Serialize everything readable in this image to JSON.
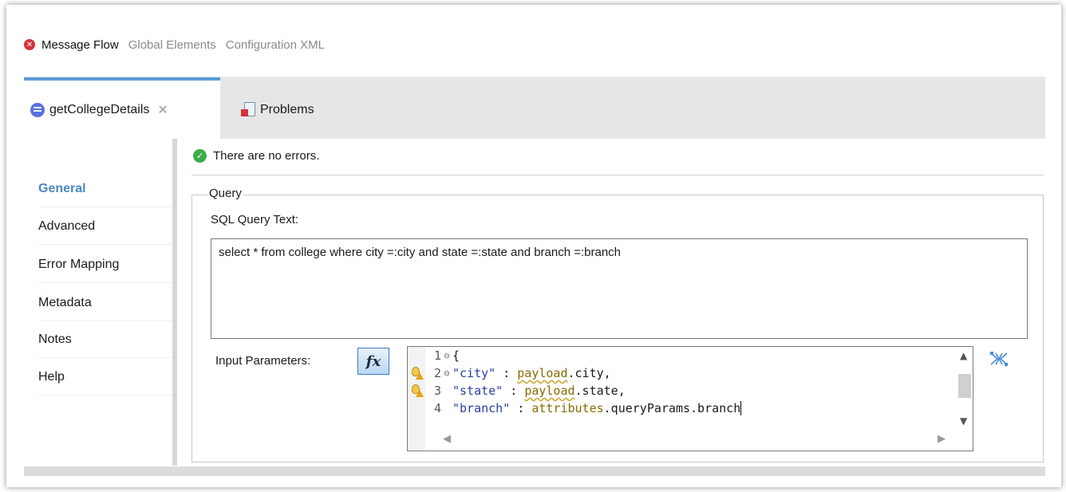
{
  "editor_tabs": [
    {
      "label": "Message Flow",
      "active": true
    },
    {
      "label": "Global Elements",
      "active": false
    },
    {
      "label": "Configuration XML",
      "active": false
    }
  ],
  "view_tabs": {
    "active": {
      "label": "getCollegeDetails",
      "icon": "database-icon"
    },
    "inactive": {
      "label": "Problems",
      "icon": "problems-icon"
    }
  },
  "sidebar": {
    "items": [
      {
        "label": "General",
        "active": true
      },
      {
        "label": "Advanced",
        "active": false
      },
      {
        "label": "Error Mapping",
        "active": false
      },
      {
        "label": "Metadata",
        "active": false
      },
      {
        "label": "Notes",
        "active": false
      },
      {
        "label": "Help",
        "active": false
      }
    ]
  },
  "status": {
    "text": "There are no errors."
  },
  "query": {
    "group_label": "Query",
    "sql_label": "SQL Query Text:",
    "sql_text": "select * from college where city =:city and state =:state and branch =:branch",
    "input_params_label": "Input Parameters:",
    "fx_label": "fx",
    "code": {
      "line1": {
        "num": "1",
        "text": "{"
      },
      "line2": {
        "num": "2",
        "key": "\"city\"",
        "sep": " : ",
        "obj": "payload",
        "rest": ".city,"
      },
      "line3": {
        "num": "3",
        "key": "\"state\"",
        "sep": " : ",
        "obj": "payload",
        "rest": ".state,"
      },
      "line4": {
        "num": "4",
        "key": "\"branch\"",
        "sep": " : ",
        "obj": "attributes",
        "rest": ".queryParams.branch"
      }
    }
  },
  "colors": {
    "accent": "#5b9bd5",
    "general_active": "#4a87c2",
    "error": "#d4323c",
    "ok": "#3dad47"
  }
}
